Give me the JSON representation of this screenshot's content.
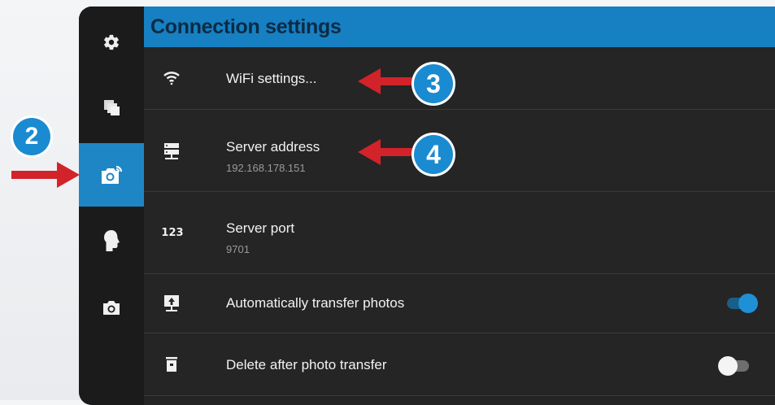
{
  "header": {
    "title": "Connection settings"
  },
  "sidebar": {
    "items": [
      {
        "icon": "gear-icon",
        "active": false
      },
      {
        "icon": "copy-icon",
        "active": false
      },
      {
        "icon": "camera-wifi-icon",
        "active": true
      },
      {
        "icon": "head-icon",
        "active": false
      },
      {
        "icon": "camera-icon",
        "active": false
      }
    ]
  },
  "rows": [
    {
      "icon": "wifi-icon",
      "label": "WiFi settings..."
    },
    {
      "icon": "server-icon",
      "label": "Server address",
      "value": "192.168.178.151"
    },
    {
      "icon": "number-icon",
      "icon_text": "123",
      "label": "Server port",
      "value": "9701"
    },
    {
      "icon": "upload-icon",
      "label": "Automatically transfer photos",
      "toggle": true
    },
    {
      "icon": "trash-icon",
      "label": "Delete after photo transfer",
      "toggle": false
    }
  ],
  "callouts": [
    {
      "number": "2",
      "color": "#1a8bd0"
    },
    {
      "number": "3",
      "color": "#1a8bd0"
    },
    {
      "number": "4",
      "color": "#1a8bd0"
    }
  ],
  "colors": {
    "accent": "#1680c2",
    "arrow": "#d2232a"
  }
}
